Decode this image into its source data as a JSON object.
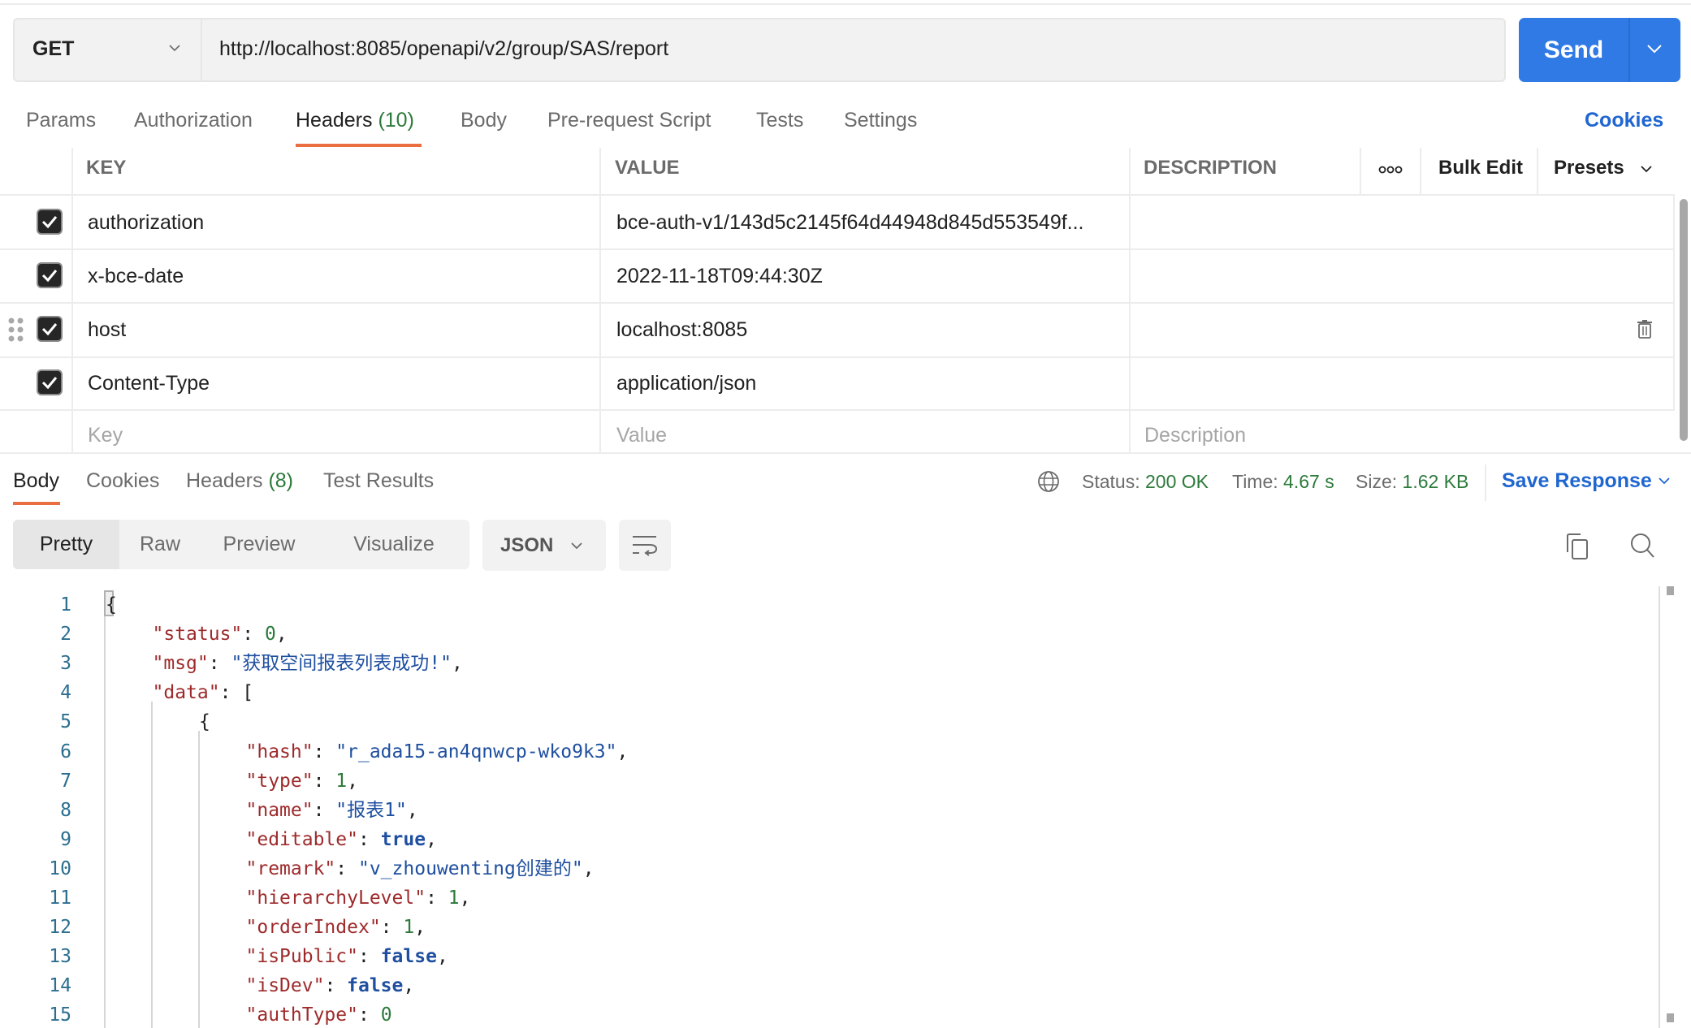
{
  "request": {
    "method": "GET",
    "url": "http://localhost:8085/openapi/v2/group/SAS/report",
    "send_label": "Send"
  },
  "request_tabs": [
    {
      "label": "Params"
    },
    {
      "label": "Authorization"
    },
    {
      "label": "Headers",
      "count": "(10)",
      "active": true
    },
    {
      "label": "Body"
    },
    {
      "label": "Pre-request Script"
    },
    {
      "label": "Tests"
    },
    {
      "label": "Settings"
    }
  ],
  "cookies_link": "Cookies",
  "headers_table": {
    "columns": {
      "key": "KEY",
      "value": "VALUE",
      "description": "DESCRIPTION"
    },
    "more_label": "ooo",
    "bulk_edit": "Bulk Edit",
    "presets": "Presets",
    "rows": [
      {
        "checked": true,
        "key": "authorization",
        "value": "bce-auth-v1/143d5c2145f64d44948d845d553549f..."
      },
      {
        "checked": true,
        "key": "x-bce-date",
        "value": "2022-11-18T09:44:30Z"
      },
      {
        "checked": true,
        "key": "host",
        "value": "localhost:8085"
      },
      {
        "checked": true,
        "key": "Content-Type",
        "value": "application/json"
      }
    ],
    "placeholders": {
      "key": "Key",
      "value": "Value",
      "description": "Description"
    }
  },
  "response": {
    "tabs": [
      {
        "label": "Body",
        "active": true
      },
      {
        "label": "Cookies"
      },
      {
        "label": "Headers",
        "count": "(8)"
      },
      {
        "label": "Test Results"
      }
    ],
    "status_label": "Status:",
    "status_value": "200 OK",
    "time_label": "Time:",
    "time_value": "4.67 s",
    "size_label": "Size:",
    "size_value": "1.62 KB",
    "save_response": "Save Response",
    "view_modes": [
      "Pretty",
      "Raw",
      "Preview",
      "Visualize"
    ],
    "active_view": "Pretty",
    "format": "JSON"
  },
  "code_lines": [
    {
      "n": "1",
      "indent": 0,
      "parts": [
        [
          "p",
          "{"
        ]
      ]
    },
    {
      "n": "2",
      "indent": 1,
      "parts": [
        [
          "k",
          "\"status\""
        ],
        [
          "p",
          ": "
        ],
        [
          "n",
          "0"
        ],
        [
          "p",
          ","
        ]
      ]
    },
    {
      "n": "3",
      "indent": 1,
      "parts": [
        [
          "k",
          "\"msg\""
        ],
        [
          "p",
          ": "
        ],
        [
          "s",
          "\"获取空间报表列表成功!\""
        ],
        [
          "p",
          ","
        ]
      ]
    },
    {
      "n": "4",
      "indent": 1,
      "parts": [
        [
          "k",
          "\"data\""
        ],
        [
          "p",
          ": ["
        ]
      ]
    },
    {
      "n": "5",
      "indent": 2,
      "parts": [
        [
          "p",
          "{"
        ]
      ]
    },
    {
      "n": "6",
      "indent": 3,
      "parts": [
        [
          "k",
          "\"hash\""
        ],
        [
          "p",
          ": "
        ],
        [
          "s",
          "\"r_ada15-an4qnwcp-wko9k3\""
        ],
        [
          "p",
          ","
        ]
      ]
    },
    {
      "n": "7",
      "indent": 3,
      "parts": [
        [
          "k",
          "\"type\""
        ],
        [
          "p",
          ": "
        ],
        [
          "n",
          "1"
        ],
        [
          "p",
          ","
        ]
      ]
    },
    {
      "n": "8",
      "indent": 3,
      "parts": [
        [
          "k",
          "\"name\""
        ],
        [
          "p",
          ": "
        ],
        [
          "s",
          "\"报表1\""
        ],
        [
          "p",
          ","
        ]
      ]
    },
    {
      "n": "9",
      "indent": 3,
      "parts": [
        [
          "k",
          "\"editable\""
        ],
        [
          "p",
          ": "
        ],
        [
          "b",
          "true"
        ],
        [
          "p",
          ","
        ]
      ]
    },
    {
      "n": "10",
      "indent": 3,
      "parts": [
        [
          "k",
          "\"remark\""
        ],
        [
          "p",
          ": "
        ],
        [
          "s",
          "\"v_zhouwenting创建的\""
        ],
        [
          "p",
          ","
        ]
      ]
    },
    {
      "n": "11",
      "indent": 3,
      "parts": [
        [
          "k",
          "\"hierarchyLevel\""
        ],
        [
          "p",
          ": "
        ],
        [
          "n",
          "1"
        ],
        [
          "p",
          ","
        ]
      ]
    },
    {
      "n": "12",
      "indent": 3,
      "parts": [
        [
          "k",
          "\"orderIndex\""
        ],
        [
          "p",
          ": "
        ],
        [
          "n",
          "1"
        ],
        [
          "p",
          ","
        ]
      ]
    },
    {
      "n": "13",
      "indent": 3,
      "parts": [
        [
          "k",
          "\"isPublic\""
        ],
        [
          "p",
          ": "
        ],
        [
          "b",
          "false"
        ],
        [
          "p",
          ","
        ]
      ]
    },
    {
      "n": "14",
      "indent": 3,
      "parts": [
        [
          "k",
          "\"isDev\""
        ],
        [
          "p",
          ": "
        ],
        [
          "b",
          "false"
        ],
        [
          "p",
          ","
        ]
      ]
    },
    {
      "n": "15",
      "indent": 3,
      "parts": [
        [
          "k",
          "\"authType\""
        ],
        [
          "p",
          ": "
        ],
        [
          "n",
          "0"
        ]
      ]
    }
  ],
  "colors": {
    "accent_blue": "#2f7ae5",
    "active_tab_underline": "#eb6e42",
    "success_green": "#2c7a3b",
    "link_blue": "#1f66d1"
  }
}
